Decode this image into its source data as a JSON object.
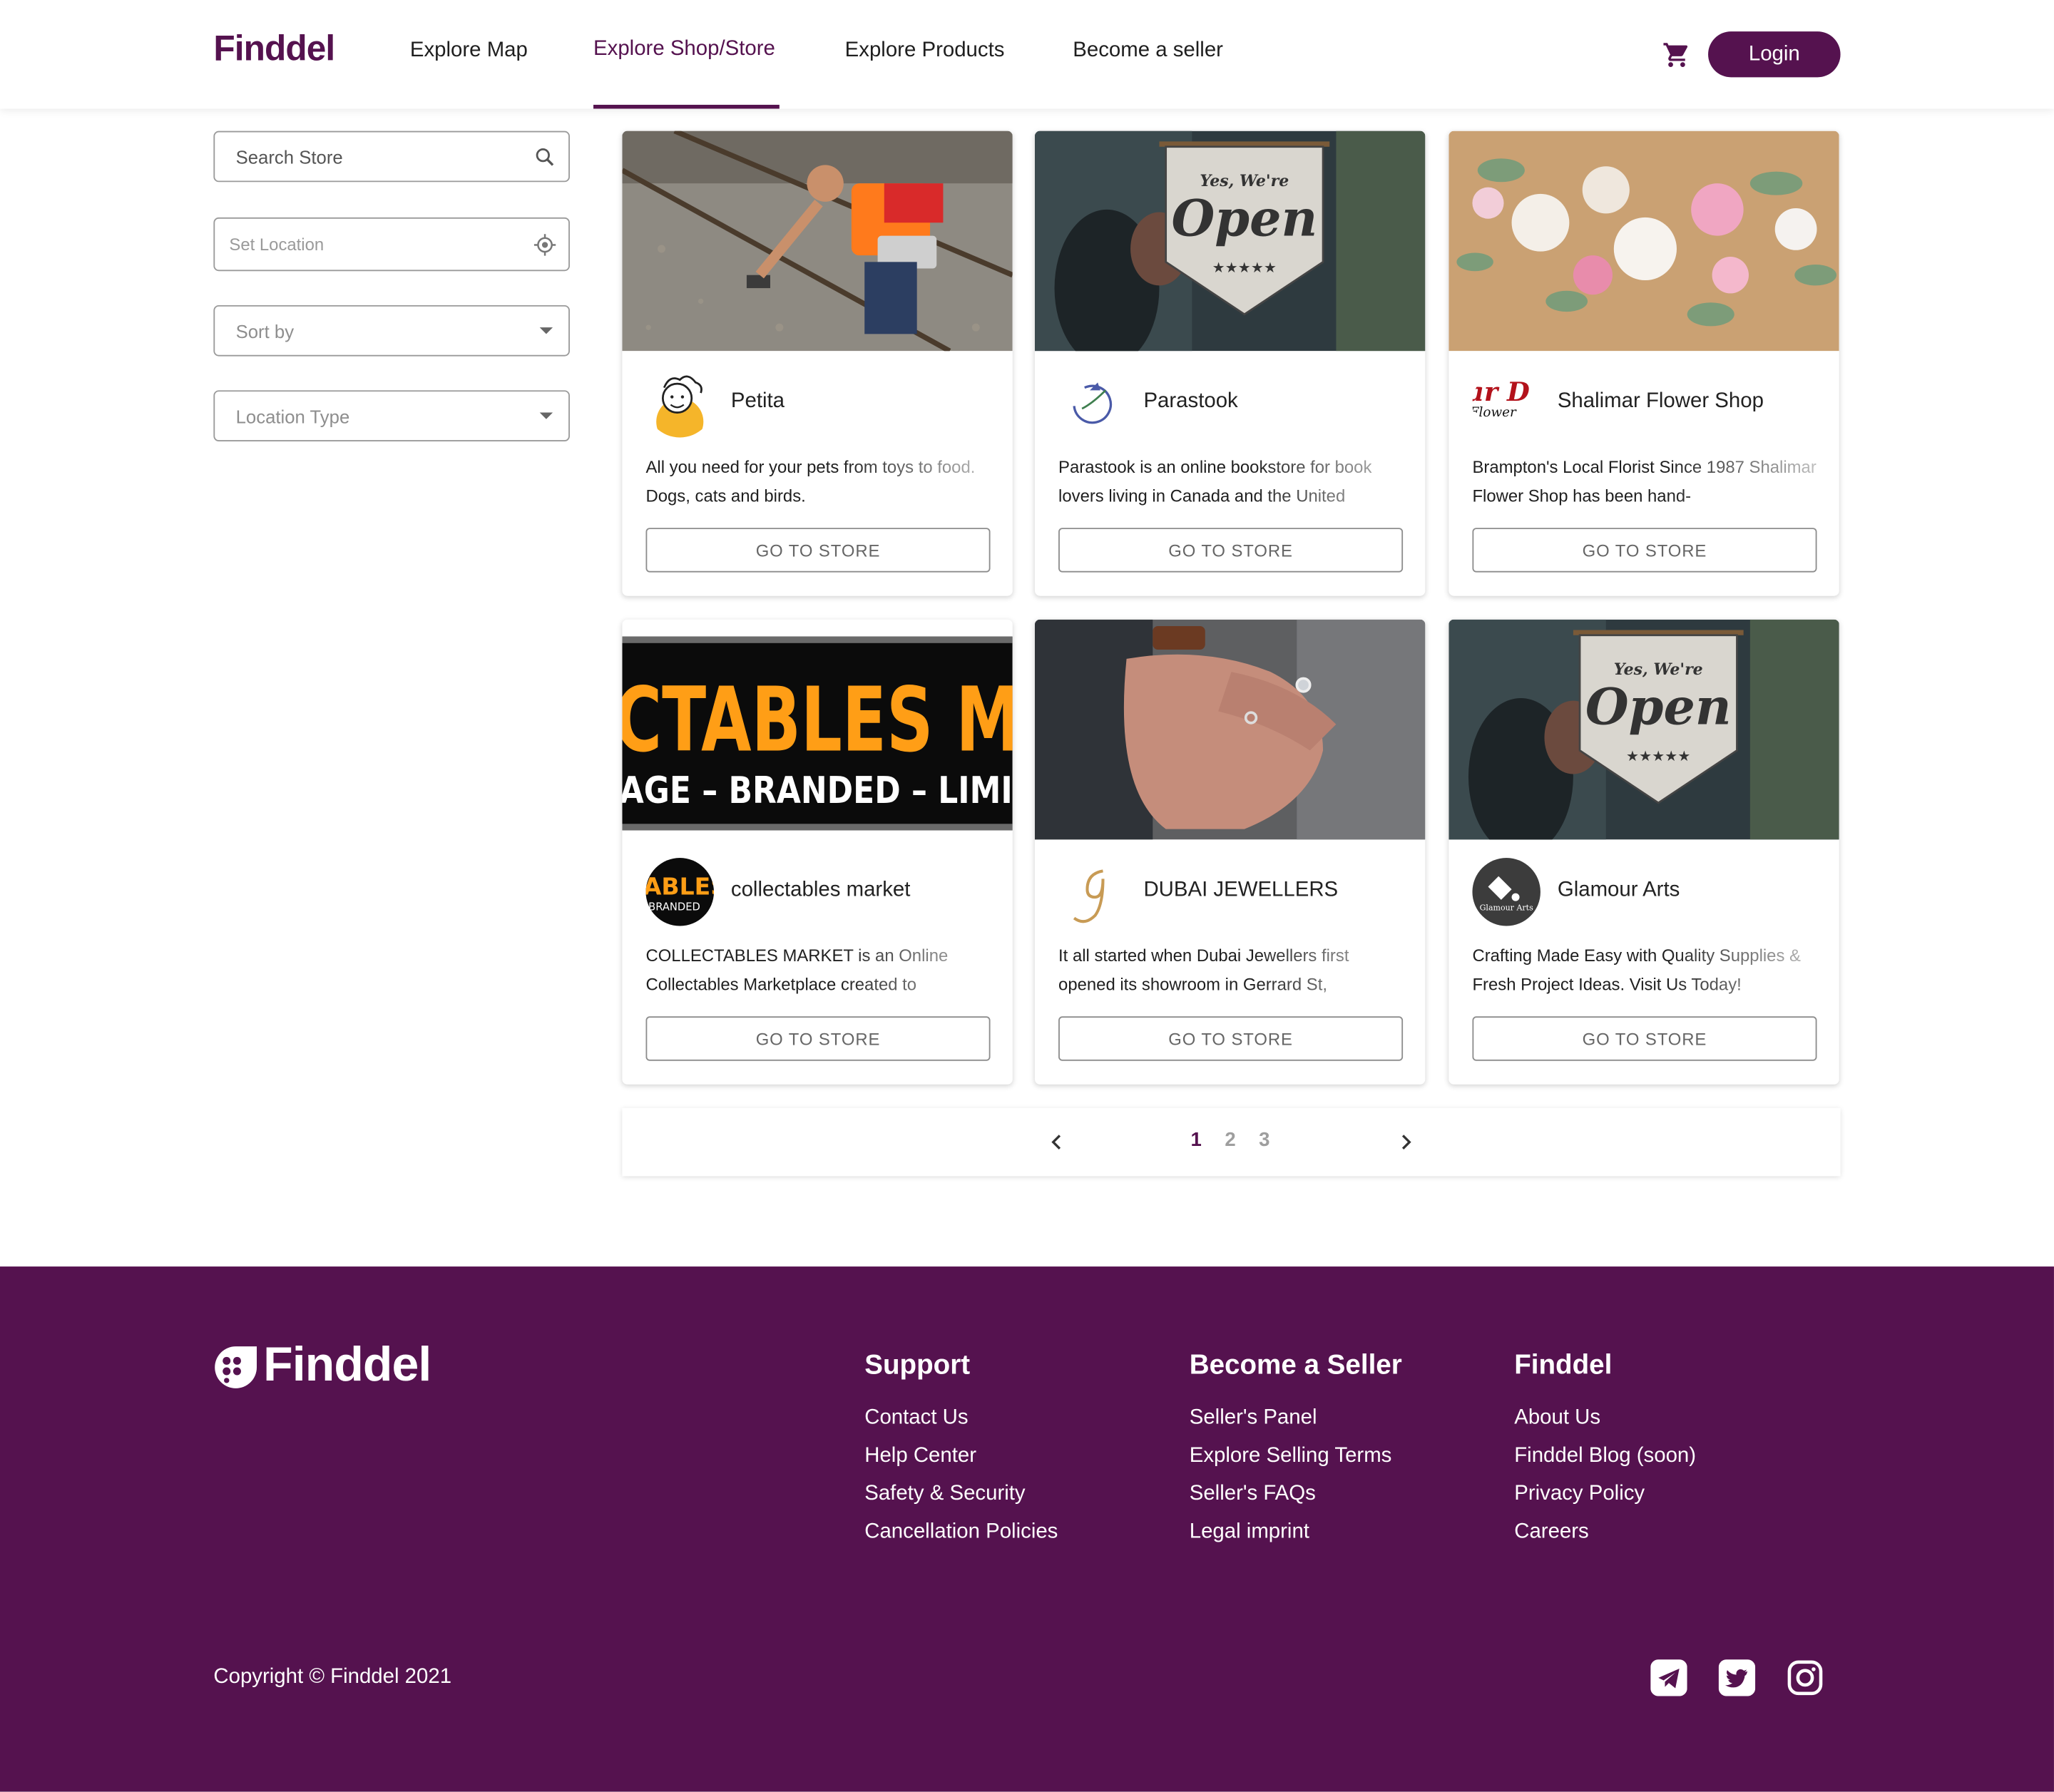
{
  "brand": "Finddel",
  "colors": {
    "primary": "#55124f",
    "footer_bg": "#55124f",
    "text": "#1f1f1f"
  },
  "nav": {
    "items": [
      "Explore Map",
      "Explore Shop/Store",
      "Explore Products",
      "Become a seller"
    ],
    "active": "Explore Shop/Store",
    "cart_icon": "cart-icon",
    "login": "Login"
  },
  "filters": {
    "search_placeholder": "Search Store",
    "location_placeholder": "Set Location",
    "sort_placeholder": "Sort by",
    "location_type_placeholder": "Location Type"
  },
  "stores": [
    {
      "name": "Petita",
      "description": "All you need for your pets from toys to food. Dogs, cats and birds.",
      "button": "GO TO STORE"
    },
    {
      "name": "Parastook",
      "description": "Parastook is an online bookstore for book lovers living in Canada and the United",
      "button": "GO TO STORE"
    },
    {
      "name": "Shalimar Flower Shop",
      "description": "Brampton's Local Florist Since 1987 Shalimar Flower Shop has been hand-",
      "button": "GO TO STORE"
    },
    {
      "name": "collectables market",
      "description": "COLLECTABLES MARKET is an Online Collectables Marketplace created to",
      "button": "GO TO STORE"
    },
    {
      "name": "DUBAI JEWELLERS",
      "description": "It all started when Dubai Jewellers first opened its showroom in Gerrard St,",
      "button": "GO TO STORE"
    },
    {
      "name": "Glamour Arts",
      "description": "Crafting Made Easy with Quality Supplies & Fresh Project Ideas. Visit Us Today!",
      "button": "GO TO STORE"
    }
  ],
  "images": {
    "open_sign_line1": "Yes, We're",
    "open_sign_line2": "Open",
    "collectables_banner_line1": "CTABLES M",
    "collectables_banner_line2": "AGE – BRANDED – LIMI",
    "shalimar_logo_text": "Flower",
    "glamour_logo_text": "Glamour Arts",
    "collectables_logo_text": "ABLES",
    "collectables_logo_sub": "BRANDED"
  },
  "pagination": {
    "pages": [
      "1",
      "2",
      "3"
    ],
    "current": "1"
  },
  "footer": {
    "logo": "Finddel",
    "columns": [
      {
        "heading": "Support",
        "links": [
          "Contact Us",
          "Help Center",
          "Safety & Security",
          "Cancellation Policies"
        ]
      },
      {
        "heading": "Become a Seller",
        "links": [
          "Seller's Panel",
          "Explore Selling Terms",
          "Seller's FAQs",
          "Legal imprint"
        ]
      },
      {
        "heading": "Finddel",
        "links": [
          "About Us",
          "Finddel Blog (soon)",
          "Privacy Policy",
          "Careers"
        ]
      }
    ],
    "copyright": "Copyright © Finddel 2021",
    "social": [
      "telegram-icon",
      "twitter-icon",
      "instagram-icon"
    ]
  }
}
